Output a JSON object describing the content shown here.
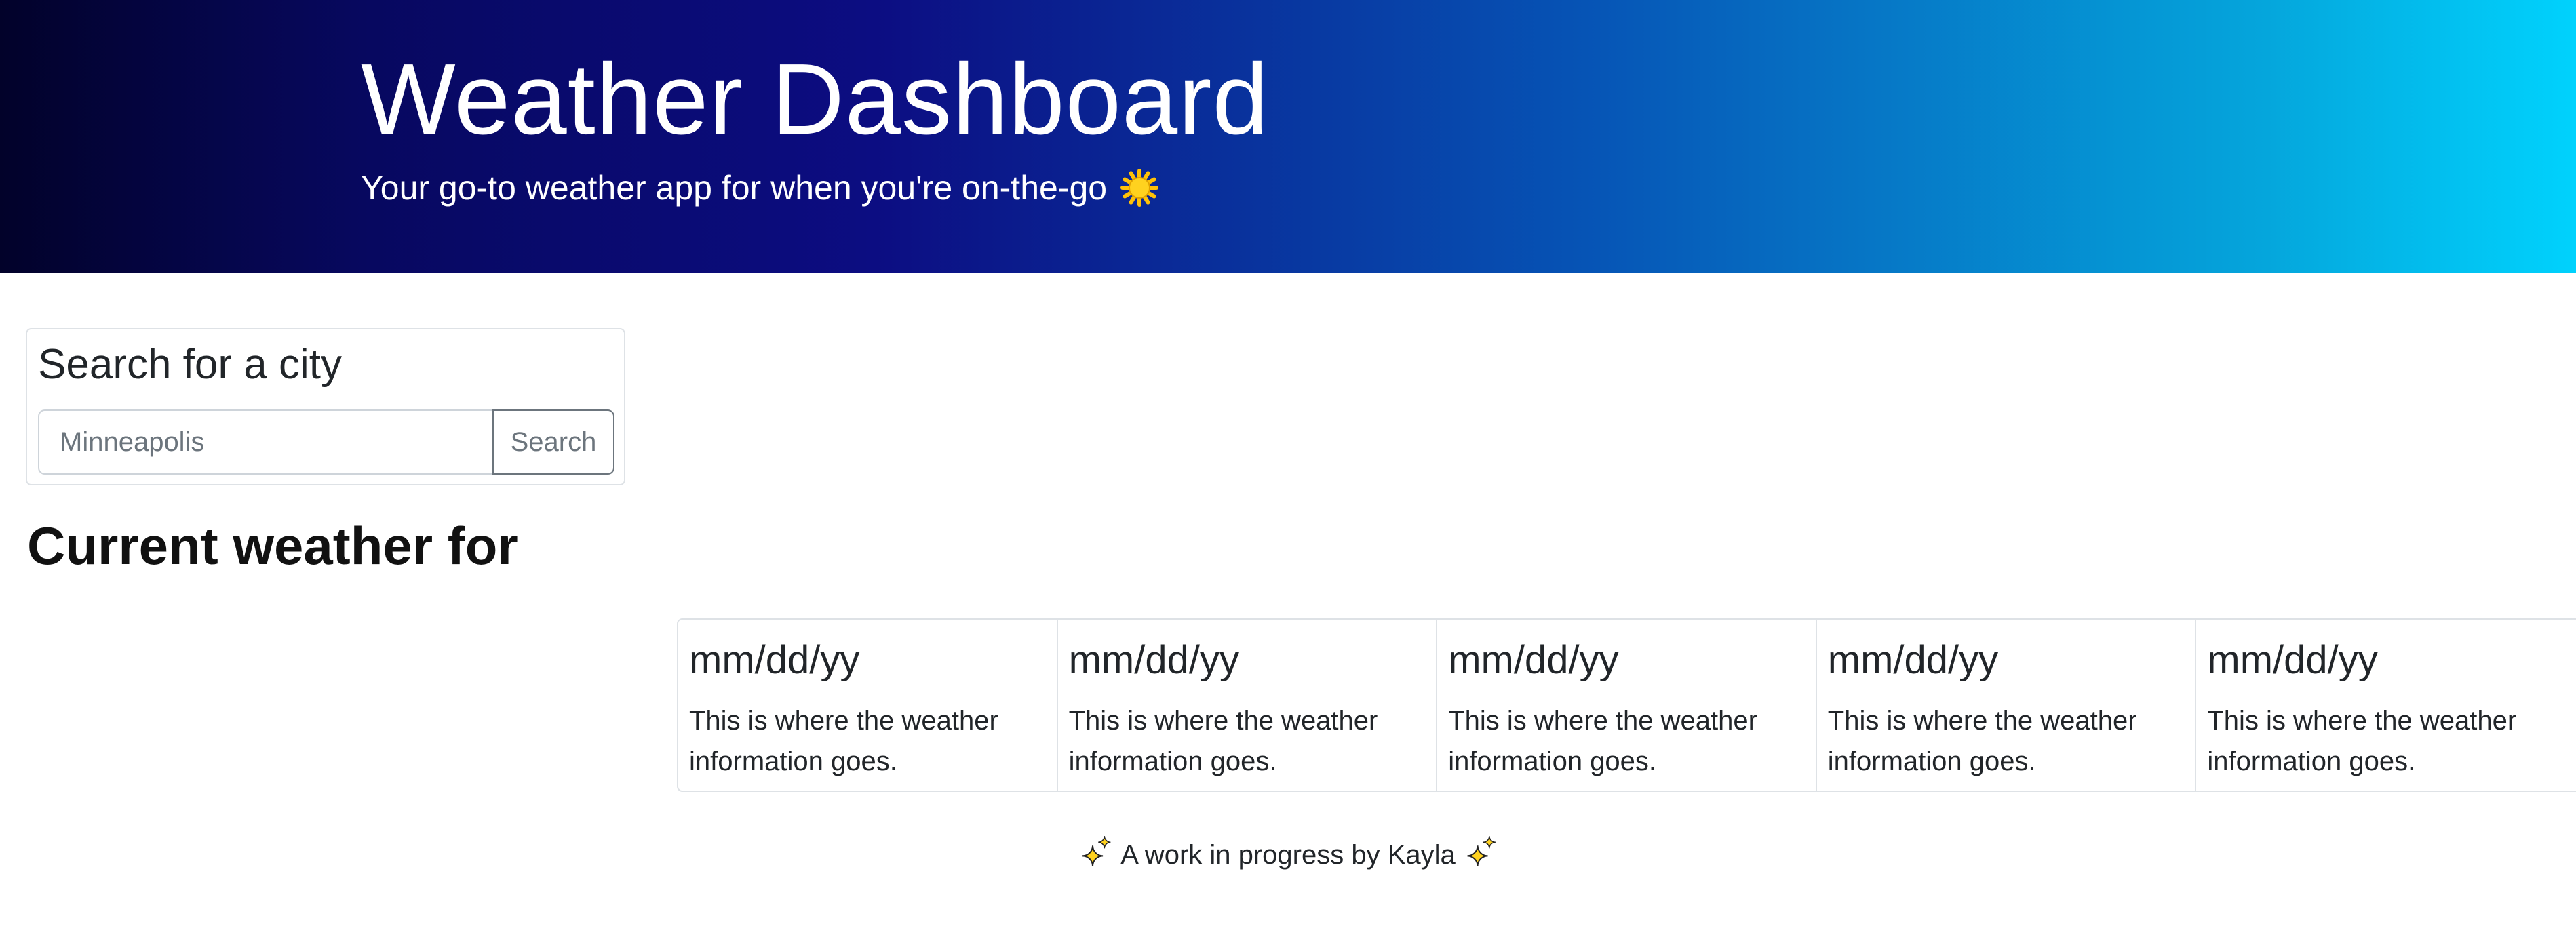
{
  "header": {
    "title": "Weather Dashboard",
    "tagline": "Your go-to weather app for when you're on-the-go",
    "tagline_icon": "sun-icon",
    "gradient_colors": [
      "#02022a",
      "#0c0d82",
      "#0655b6",
      "#00d2fd"
    ]
  },
  "search": {
    "title": "Search for a city",
    "placeholder": "Minneapolis",
    "value": "",
    "button_label": "Search"
  },
  "current": {
    "heading": "Current weather for"
  },
  "forecast": [
    {
      "date": "mm/dd/yy",
      "info": "This is where the weather information goes."
    },
    {
      "date": "mm/dd/yy",
      "info": "This is where the weather information goes."
    },
    {
      "date": "mm/dd/yy",
      "info": "This is where the weather information goes."
    },
    {
      "date": "mm/dd/yy",
      "info": "This is where the weather information goes."
    },
    {
      "date": "mm/dd/yy",
      "info": "This is where the weather information goes."
    }
  ],
  "footer": {
    "text": "A work in progress by Kayla",
    "icon": "sparkles-icon"
  }
}
